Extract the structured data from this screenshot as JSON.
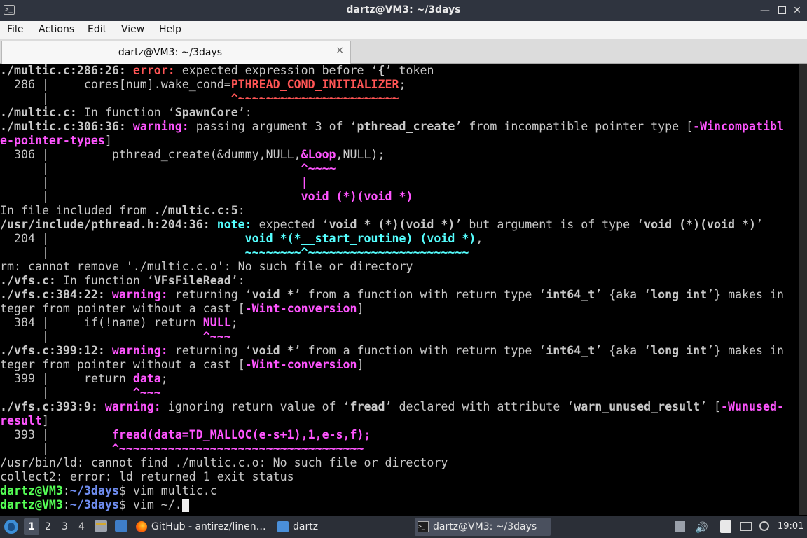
{
  "window": {
    "title": "dartz@VM3: ~/3days"
  },
  "menu": {
    "items": [
      "File",
      "Actions",
      "Edit",
      "View",
      "Help"
    ]
  },
  "tab": {
    "label": "dartz@VM3: ~/3days",
    "close": "×"
  },
  "terminal_lines": [
    [
      {
        "t": "./multic.c:286:26: ",
        "c": "b"
      },
      {
        "t": "error: ",
        "c": "r"
      },
      {
        "t": "expected expression before ‘"
      },
      {
        "t": "{",
        "c": "b"
      },
      {
        "t": "’ token"
      }
    ],
    [
      {
        "t": "  286 |     cores[num].wake_cond="
      },
      {
        "t": "PTHREAD_COND_INITIALIZER",
        "c": "r"
      },
      {
        "t": ";"
      }
    ],
    [
      {
        "t": "      |                          "
      },
      {
        "t": "^~~~~~~~~~~~~~~~~~~~~~~~",
        "c": "r"
      }
    ],
    [
      {
        "t": "./multic.c:",
        "c": "b"
      },
      {
        "t": " In function ‘"
      },
      {
        "t": "SpawnCore",
        "c": "b"
      },
      {
        "t": "’:"
      }
    ],
    [
      {
        "t": "./multic.c:306:36: ",
        "c": "b"
      },
      {
        "t": "warning: ",
        "c": "m"
      },
      {
        "t": "passing argument 3 of ‘"
      },
      {
        "t": "pthread_create",
        "c": "b"
      },
      {
        "t": "’ from incompatible pointer type ["
      },
      {
        "t": "-Wincompatibl",
        "c": "m"
      }
    ],
    [
      {
        "t": "e-pointer-types",
        "c": "m"
      },
      {
        "t": "]"
      }
    ],
    [
      {
        "t": "  306 |         pthread_create(&dummy,NULL,"
      },
      {
        "t": "&Loop",
        "c": "m"
      },
      {
        "t": ",NULL);"
      }
    ],
    [
      {
        "t": "      |                                    "
      },
      {
        "t": "^~~~~",
        "c": "m"
      }
    ],
    [
      {
        "t": "      |                                    "
      },
      {
        "t": "|",
        "c": "m"
      }
    ],
    [
      {
        "t": "      |                                    "
      },
      {
        "t": "void (*)(void *)",
        "c": "m"
      }
    ],
    [
      {
        "t": "In file included from "
      },
      {
        "t": "./multic.c:5",
        "c": "b"
      },
      {
        "t": ":"
      }
    ],
    [
      {
        "t": "/usr/include/pthread.h:204:36: ",
        "c": "b"
      },
      {
        "t": "note: ",
        "c": "c"
      },
      {
        "t": "expected ‘"
      },
      {
        "t": "void * (*)(void *)",
        "c": "b"
      },
      {
        "t": "’ but argument is of type ‘"
      },
      {
        "t": "void (*)(void *)",
        "c": "b"
      },
      {
        "t": "’"
      }
    ],
    [
      {
        "t": "  204 |                            "
      },
      {
        "t": "void *(*__start_routine) (void *)",
        "c": "c"
      },
      {
        "t": ","
      }
    ],
    [
      {
        "t": "      |                            "
      },
      {
        "t": "~~~~~~~~^~~~~~~~~~~~~~~~~~~~~~~~",
        "c": "c"
      }
    ],
    [
      {
        "t": "rm: cannot remove './multic.c.o': No such file or directory"
      }
    ],
    [
      {
        "t": "./vfs.c:",
        "c": "b"
      },
      {
        "t": " In function ‘"
      },
      {
        "t": "VFsFileRead",
        "c": "b"
      },
      {
        "t": "’:"
      }
    ],
    [
      {
        "t": "./vfs.c:384:22: ",
        "c": "b"
      },
      {
        "t": "warning: ",
        "c": "m"
      },
      {
        "t": "returning ‘"
      },
      {
        "t": "void *",
        "c": "b"
      },
      {
        "t": "’ from a function with return type ‘"
      },
      {
        "t": "int64_t",
        "c": "b"
      },
      {
        "t": "’ {aka ‘"
      },
      {
        "t": "long int",
        "c": "b"
      },
      {
        "t": "’} makes in"
      }
    ],
    [
      {
        "t": "teger from pointer without a cast ["
      },
      {
        "t": "-Wint-conversion",
        "c": "m"
      },
      {
        "t": "]"
      }
    ],
    [
      {
        "t": "  384 |     if(!name) return "
      },
      {
        "t": "NULL",
        "c": "m"
      },
      {
        "t": ";"
      }
    ],
    [
      {
        "t": "      |                      "
      },
      {
        "t": "^~~~",
        "c": "m"
      }
    ],
    [
      {
        "t": "./vfs.c:399:12: ",
        "c": "b"
      },
      {
        "t": "warning: ",
        "c": "m"
      },
      {
        "t": "returning ‘"
      },
      {
        "t": "void *",
        "c": "b"
      },
      {
        "t": "’ from a function with return type ‘"
      },
      {
        "t": "int64_t",
        "c": "b"
      },
      {
        "t": "’ {aka ‘"
      },
      {
        "t": "long int",
        "c": "b"
      },
      {
        "t": "’} makes in"
      }
    ],
    [
      {
        "t": "teger from pointer without a cast ["
      },
      {
        "t": "-Wint-conversion",
        "c": "m"
      },
      {
        "t": "]"
      }
    ],
    [
      {
        "t": "  399 |     return "
      },
      {
        "t": "data",
        "c": "m"
      },
      {
        "t": ";"
      }
    ],
    [
      {
        "t": "      |            "
      },
      {
        "t": "^~~~",
        "c": "m"
      }
    ],
    [
      {
        "t": "./vfs.c:393:9: ",
        "c": "b"
      },
      {
        "t": "warning: ",
        "c": "m"
      },
      {
        "t": "ignoring return value of ‘"
      },
      {
        "t": "fread",
        "c": "b"
      },
      {
        "t": "’ declared with attribute ‘"
      },
      {
        "t": "warn_unused_result",
        "c": "b"
      },
      {
        "t": "’ ["
      },
      {
        "t": "-Wunused-",
        "c": "m"
      }
    ],
    [
      {
        "t": "result",
        "c": "m"
      },
      {
        "t": "]"
      }
    ],
    [
      {
        "t": "  393 |         "
      },
      {
        "t": "fread(data=TD_MALLOC(e-s+1),1,e-s,f);",
        "c": "m"
      }
    ],
    [
      {
        "t": "      |         "
      },
      {
        "t": "^~~~~~~~~~~~~~~~~~~~~~~~~~~~~~~~~~~~",
        "c": "m"
      }
    ],
    [
      {
        "t": "/usr/bin/ld: cannot find ./multic.c.o: No such file or directory"
      }
    ],
    [
      {
        "t": "collect2: error: ld returned 1 exit status"
      }
    ],
    [
      {
        "t": "dartz@VM3",
        "c": "g"
      },
      {
        "t": ":"
      },
      {
        "t": "~/3days",
        "c": "bl"
      },
      {
        "t": "$ vim multic.c"
      }
    ],
    [
      {
        "t": "dartz@VM3",
        "c": "g"
      },
      {
        "t": ":"
      },
      {
        "t": "~/3days",
        "c": "bl"
      },
      {
        "t": "$ vim ~/."
      }
    ]
  ],
  "taskbar": {
    "workspaces": [
      "1",
      "2",
      "3",
      "4"
    ],
    "apps": [
      {
        "label": "GitHub - antirez/linen…",
        "icon": "firefox-icon"
      },
      {
        "label": "dartz",
        "icon": "folder-icon"
      },
      {
        "label": "dartz@VM3: ~/3days",
        "icon": "terminal-icon"
      }
    ],
    "clock": "19:01"
  }
}
